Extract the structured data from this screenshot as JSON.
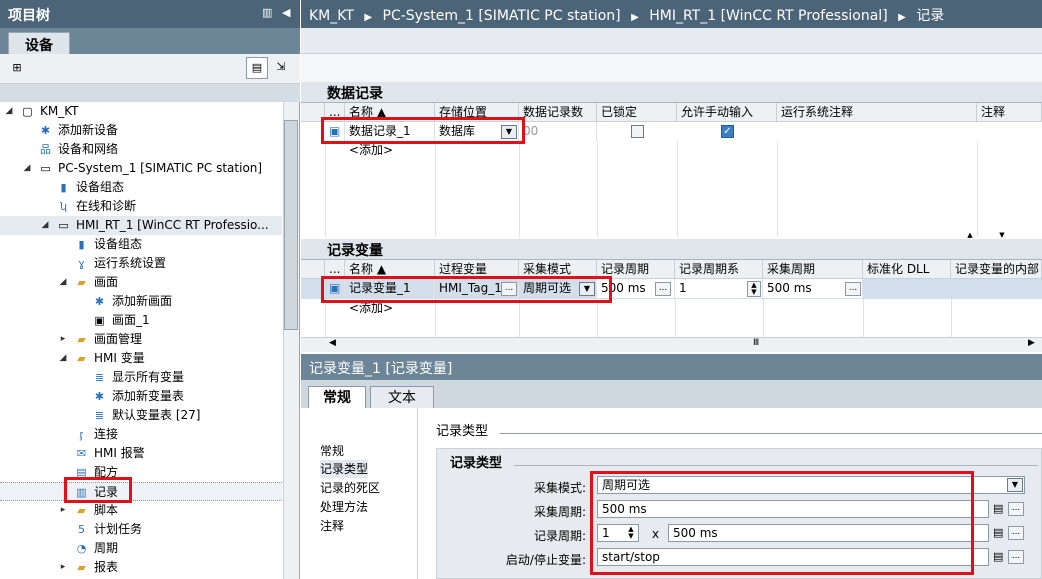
{
  "left": {
    "title": "项目树",
    "tab": "设备",
    "tree": [
      {
        "label": "KM_KT"
      },
      {
        "label": "添加新设备"
      },
      {
        "label": "设备和网络"
      },
      {
        "label": "PC-System_1 [SIMATIC PC station]"
      },
      {
        "label": "设备组态"
      },
      {
        "label": "在线和诊断"
      },
      {
        "label": "HMI_RT_1 [WinCC RT Professio..."
      },
      {
        "label": "设备组态"
      },
      {
        "label": "运行系统设置"
      },
      {
        "label": "画面"
      },
      {
        "label": "添加新画面"
      },
      {
        "label": "画面_1"
      },
      {
        "label": "画面管理"
      },
      {
        "label": "HMI 变量"
      },
      {
        "label": "显示所有变量"
      },
      {
        "label": "添加新变量表"
      },
      {
        "label": "默认变量表 [27]"
      },
      {
        "label": "连接"
      },
      {
        "label": "HMI 报警"
      },
      {
        "label": "配方"
      },
      {
        "label": "记录"
      },
      {
        "label": "脚本"
      },
      {
        "label": "计划任务"
      },
      {
        "label": "周期"
      },
      {
        "label": "报表"
      }
    ]
  },
  "breadcrumb": {
    "part1": "KM_KT",
    "part2": "PC-System_1 [SIMATIC PC station]",
    "part3": "HMI_RT_1 [WinCC RT Professional]",
    "part4": "记录"
  },
  "datalog": {
    "title": "数据记录",
    "columns": [
      "...",
      "名称 ▲",
      "存储位置",
      "数据记录数",
      "已锁定",
      "允许手动输入",
      "运行系统注释",
      "注释"
    ],
    "row": {
      "name": "数据记录_1",
      "storage": "数据库",
      "count": "00"
    },
    "add": "<添加>"
  },
  "logtags": {
    "title": "记录变量",
    "columns": [
      "...",
      "名称 ▲",
      "过程变量",
      "采集模式",
      "记录周期",
      "记录周期系",
      "采集周期",
      "标准化 DLL",
      "记录变量的内部"
    ],
    "row": {
      "name": "记录变量_1",
      "tag": "HMI_Tag_1",
      "mode": "周期可选",
      "cycle": "500 ms",
      "factor": "1",
      "acq": "500 ms"
    },
    "add": "<添加>"
  },
  "props": {
    "title": "记录变量_1 [记录变量]",
    "tab_general": "常规",
    "tab_text": "文本",
    "nav": [
      "常规",
      "记录类型",
      "记录的死区",
      "处理方法",
      "注释"
    ],
    "section_header": "记录类型",
    "group_title": "记录类型",
    "labels": {
      "mode": "采集模式:",
      "acq": "采集周期:",
      "log": "记录周期:",
      "startstop": "启动/停止变量:"
    },
    "values": {
      "mode": "周期可选",
      "acq": "500 ms",
      "factor": "1",
      "x": "x",
      "log": "500 ms",
      "startstop": "start/stop"
    }
  },
  "colors": {
    "title_bar": "#4b6477",
    "highlight": "#e0101a"
  }
}
